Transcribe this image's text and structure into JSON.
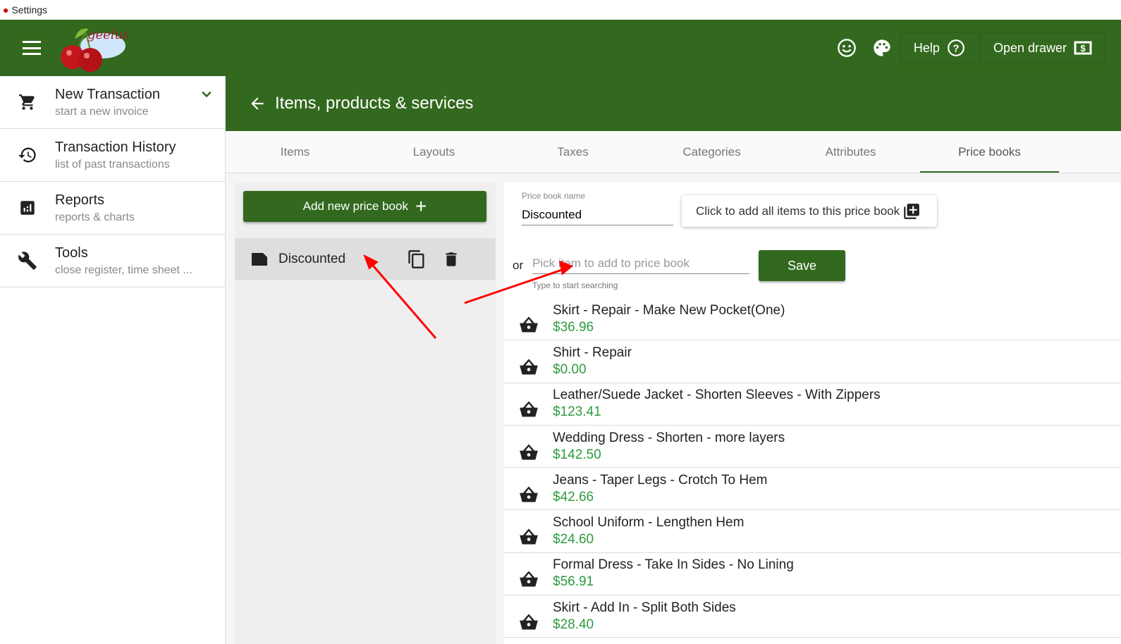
{
  "window": {
    "title": "Settings"
  },
  "topbar": {
    "help_label": "Help",
    "drawer_label": "Open drawer",
    "logo_text": "geelus"
  },
  "sidebar": {
    "items": [
      {
        "title": "New Transaction",
        "subtitle": "start a new invoice"
      },
      {
        "title": "Transaction History",
        "subtitle": "list of past transactions"
      },
      {
        "title": "Reports",
        "subtitle": "reports & charts"
      },
      {
        "title": "Tools",
        "subtitle": "close register, time sheet ..."
      }
    ]
  },
  "page": {
    "title": "Items, products & services"
  },
  "tabs": [
    "Items",
    "Layouts",
    "Taxes",
    "Categories",
    "Attributes",
    "Price books"
  ],
  "left": {
    "add_label": "Add new price book",
    "books": [
      {
        "name": "Discounted"
      }
    ]
  },
  "form": {
    "name_label": "Price book name",
    "name_value": "Discounted",
    "add_all_label": "Click to add all items to this price book",
    "or": "or",
    "pick_placeholder": "Pick item to add to price book",
    "pick_hint": "Type to start searching",
    "save_label": "Save"
  },
  "items": [
    {
      "name": "Skirt - Repair - Make New Pocket(One)",
      "price": "$36.96"
    },
    {
      "name": "Shirt - Repair",
      "price": "$0.00"
    },
    {
      "name": "Leather/Suede Jacket - Shorten Sleeves - With Zippers",
      "price": "$123.41"
    },
    {
      "name": "Wedding Dress - Shorten - more layers",
      "price": "$142.50"
    },
    {
      "name": "Jeans - Taper Legs - Crotch To Hem",
      "price": "$42.66"
    },
    {
      "name": "School Uniform - Lengthen Hem",
      "price": "$24.60"
    },
    {
      "name": "Formal Dress - Take In Sides - No Lining",
      "price": "$56.91"
    },
    {
      "name": "Skirt - Add In - Split Both Sides",
      "price": "$28.40"
    }
  ]
}
